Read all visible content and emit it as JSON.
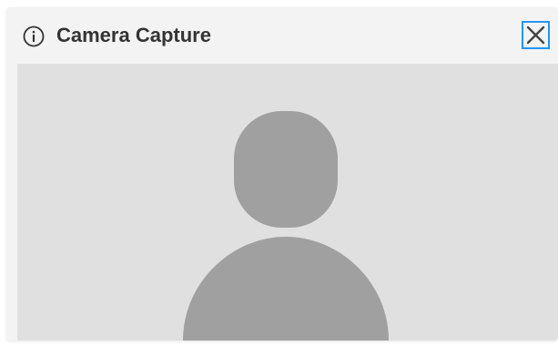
{
  "dialog": {
    "title": "Camera Capture",
    "info_icon": "info-circle-icon",
    "close_icon": "close-x-icon"
  },
  "preview": {
    "placeholder_icon": "person-silhouette-icon"
  },
  "colors": {
    "dialog_background": "#f3f3f3",
    "preview_background": "#e0e0e0",
    "silhouette": "#a0a0a0",
    "title_text": "#333333",
    "focus_outline": "#2196f3"
  }
}
